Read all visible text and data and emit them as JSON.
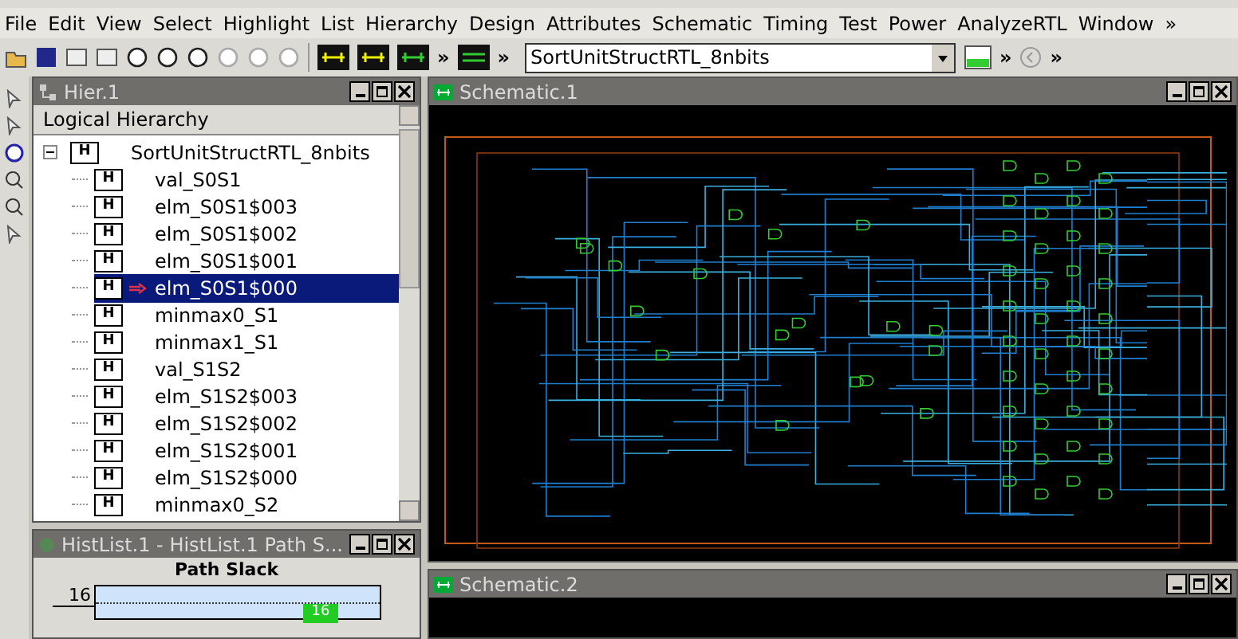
{
  "menu": [
    "File",
    "Edit",
    "View",
    "Select",
    "Highlight",
    "List",
    "Hierarchy",
    "Design",
    "Attributes",
    "Schematic",
    "Timing",
    "Test",
    "Power",
    "AnalyzeRTL",
    "Window",
    "»"
  ],
  "toolbar": {
    "design_select": "SortUnitStructRTL_8nbits",
    "overflow": "»"
  },
  "hier_panel": {
    "title": "Hier.1",
    "header": "Logical Hierarchy",
    "tree": {
      "label": "SortUnitStructRTL_8nbits",
      "badge": "H",
      "expanded": true,
      "selected": false,
      "children": [
        {
          "label": "val_S0S1",
          "badge": "H",
          "selected": false
        },
        {
          "label": "elm_S0S1$003",
          "badge": "H",
          "selected": false
        },
        {
          "label": "elm_S0S1$002",
          "badge": "H",
          "selected": false
        },
        {
          "label": "elm_S0S1$001",
          "badge": "H",
          "selected": false
        },
        {
          "label": "elm_S0S1$000",
          "badge": "H",
          "selected": true
        },
        {
          "label": "minmax0_S1",
          "badge": "H",
          "selected": false
        },
        {
          "label": "minmax1_S1",
          "badge": "H",
          "selected": false
        },
        {
          "label": "val_S1S2",
          "badge": "H",
          "selected": false
        },
        {
          "label": "elm_S1S2$003",
          "badge": "H",
          "selected": false
        },
        {
          "label": "elm_S1S2$002",
          "badge": "H",
          "selected": false
        },
        {
          "label": "elm_S1S2$001",
          "badge": "H",
          "selected": false
        },
        {
          "label": "elm_S1S2$000",
          "badge": "H",
          "selected": false
        },
        {
          "label": "minmax0_S2",
          "badge": "H",
          "selected": false
        }
      ]
    }
  },
  "hist_panel": {
    "title": "HistList.1 - HistList.1    Path S...",
    "chart_title": "Path Slack",
    "y_tick": "16",
    "bar_label": "16"
  },
  "schematic_1": {
    "title": "Schematic.1"
  },
  "schematic_2": {
    "title": "Schematic.2"
  }
}
